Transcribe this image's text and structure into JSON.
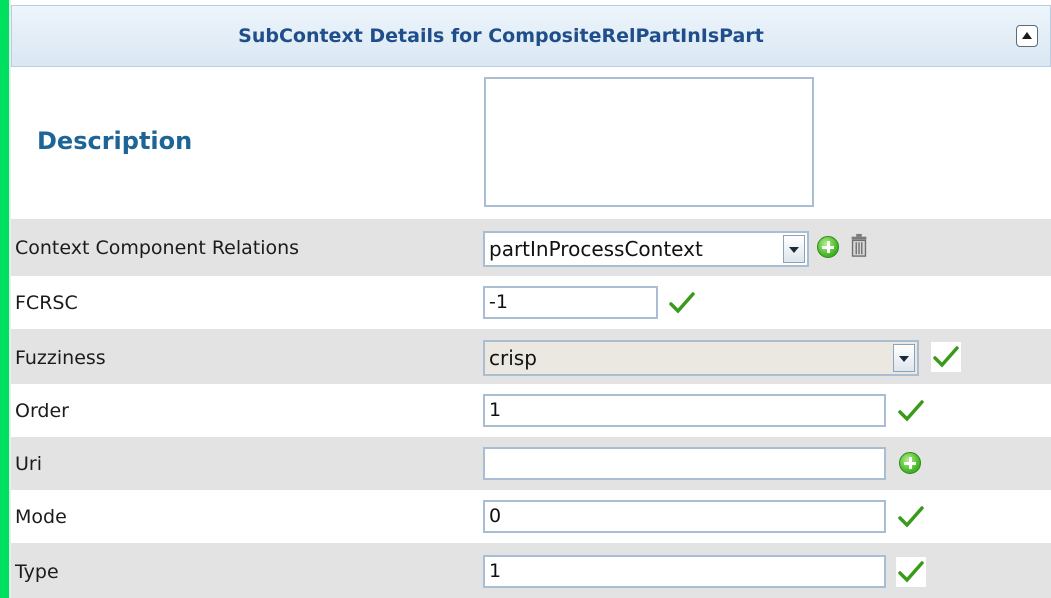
{
  "header": {
    "title": "SubContext Details for CompositeRelPartInIsPart"
  },
  "description": {
    "label": "Description",
    "value": ""
  },
  "fields": {
    "context_component_relations": {
      "label": "Context Component Relations",
      "value": "partInProcessContext"
    },
    "fcrsc": {
      "label": "FCRSC",
      "value": "-1"
    },
    "fuzziness": {
      "label": "Fuzziness",
      "value": "crisp"
    },
    "order": {
      "label": "Order",
      "value": "1"
    },
    "uri": {
      "label": "Uri",
      "value": ""
    },
    "mode": {
      "label": "Mode",
      "value": "0"
    },
    "type": {
      "label": "Type",
      "value": "1"
    }
  },
  "colors": {
    "accent_bar": "#00e060",
    "header_text": "#1f4e8a",
    "description_label": "#1d6597",
    "row_shade": "#e3e3e3",
    "check_green": "#3a9a1a"
  },
  "icons": [
    "collapse-up-icon",
    "dropdown-arrow-icon",
    "add-icon",
    "trash-icon",
    "checkmark-icon"
  ]
}
